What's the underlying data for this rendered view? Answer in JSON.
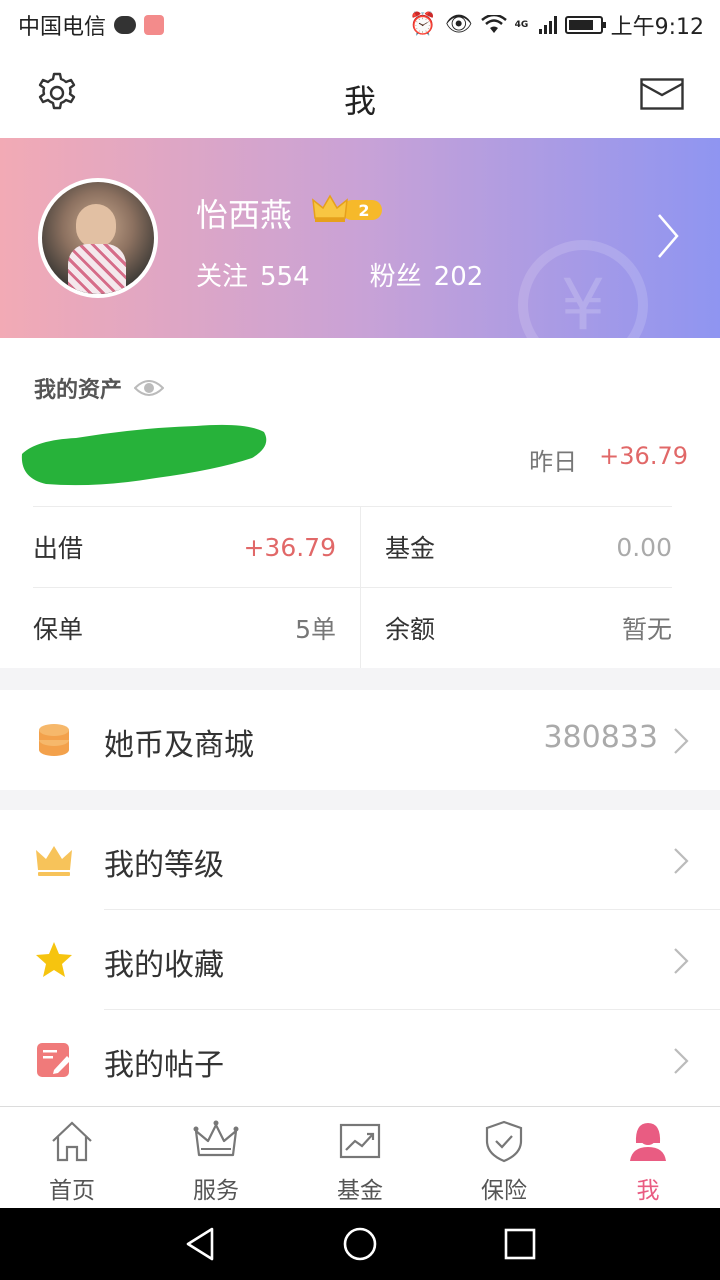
{
  "status_bar": {
    "carrier": "中国电信",
    "network": "4G",
    "time": "上午9:12"
  },
  "header": {
    "title": "我",
    "left_icon": "settings-gear-icon",
    "right_icon": "mail-envelope-icon"
  },
  "profile": {
    "nickname": "怡西燕",
    "level_badge": "2",
    "following_label": "关注",
    "following_count": "554",
    "followers_label": "粉丝",
    "followers_count": "202",
    "watermark_symbol": "¥"
  },
  "assets": {
    "title": "我的资产",
    "yesterday_label": "昨日",
    "yesterday_value": "+36.79",
    "grid": [
      {
        "label": "出借",
        "value": "+36.79"
      },
      {
        "label": "基金",
        "value": "0.00"
      },
      {
        "label": "保单",
        "value": "5单"
      },
      {
        "label": "余额",
        "value": "暂无"
      }
    ]
  },
  "coins": {
    "label": "她币及商城",
    "value": "380833",
    "icon": "coin-stack-icon"
  },
  "menu": [
    {
      "label": "我的等级",
      "icon": "crown-icon"
    },
    {
      "label": "我的收藏",
      "icon": "star-icon"
    },
    {
      "label": "我的帖子",
      "icon": "post-edit-icon"
    }
  ],
  "tabs": [
    {
      "label": "首页",
      "icon": "home-icon"
    },
    {
      "label": "服务",
      "icon": "crown-outline-icon"
    },
    {
      "label": "基金",
      "icon": "chart-trend-icon"
    },
    {
      "label": "保险",
      "icon": "shield-check-icon"
    },
    {
      "label": "我",
      "icon": "user-icon",
      "active": true
    }
  ],
  "colors": {
    "accent_pink": "#e95c82",
    "positive_red": "#e16868",
    "banner_start": "#f2aab5",
    "banner_end": "#8f95f1",
    "coin_orange": "#f3a14b",
    "crown_gold": "#f7c35a",
    "star_yellow": "#f6c40f",
    "post_red": "#f07a7a"
  }
}
